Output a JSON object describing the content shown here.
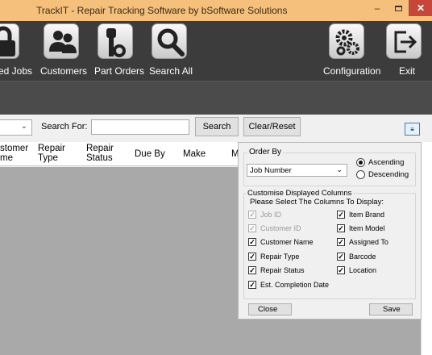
{
  "window": {
    "title": "TrackIT - Repair Tracking Software by bSoftware Solutions",
    "minimize": "–",
    "close": "✕"
  },
  "toolbar": {
    "items": [
      {
        "label": "ed Jobs",
        "icon": "lock-icon"
      },
      {
        "label": "Customers",
        "icon": "customers-icon"
      },
      {
        "label": "Part Orders",
        "icon": "key-icon"
      },
      {
        "label": "Search All",
        "icon": "search-icon"
      },
      {
        "label": "Configuration",
        "icon": "gears-icon"
      },
      {
        "label": "Exit",
        "icon": "exit-icon"
      }
    ]
  },
  "search": {
    "for_label": "Search For:",
    "value": "",
    "search_button": "Search",
    "clear_button": "Clear/Reset",
    "options_button": "≡",
    "chevron": "⌄"
  },
  "grid": {
    "columns": [
      {
        "line1": "stomer",
        "line2": "me"
      },
      {
        "line1": "Repair",
        "line2": "Type"
      },
      {
        "line1": "Repair",
        "line2": "Status"
      },
      {
        "line1": "Due By",
        "line2": ""
      },
      {
        "line1": "Make",
        "line2": ""
      },
      {
        "line1": "M",
        "line2": ""
      }
    ]
  },
  "panel": {
    "order_by": {
      "legend": "Order By",
      "selected": "Job Number",
      "chevron": "⌄",
      "ascending": "Ascending",
      "descending": "Descending",
      "direction": "ascending"
    },
    "columns": {
      "legend": "Customise Displayed Columns",
      "instruction": "Please Select The Columns To Display:",
      "left": [
        {
          "label": "Job ID",
          "checked": true,
          "disabled": true
        },
        {
          "label": "Customer ID",
          "checked": true,
          "disabled": true
        },
        {
          "label": "Customer Name",
          "checked": true,
          "disabled": false
        },
        {
          "label": "Repair Type",
          "checked": true,
          "disabled": false
        },
        {
          "label": "Repair Status",
          "checked": true,
          "disabled": false
        },
        {
          "label": "Est. Completion Date",
          "checked": true,
          "disabled": false
        }
      ],
      "right": [
        {
          "label": "Item Brand",
          "checked": true,
          "disabled": false
        },
        {
          "label": "Item Model",
          "checked": true,
          "disabled": false
        },
        {
          "label": "Assigned To",
          "checked": true,
          "disabled": false
        },
        {
          "label": "Barcode",
          "checked": true,
          "disabled": false
        },
        {
          "label": "Location",
          "checked": true,
          "disabled": false
        }
      ]
    },
    "close_button": "Close",
    "save_button": "Save"
  },
  "colors": {
    "titlebar": "#f5c07b",
    "toolbar": "#3c3c3c",
    "grid_body": "#a9a9a9",
    "close": "#c7463c"
  }
}
